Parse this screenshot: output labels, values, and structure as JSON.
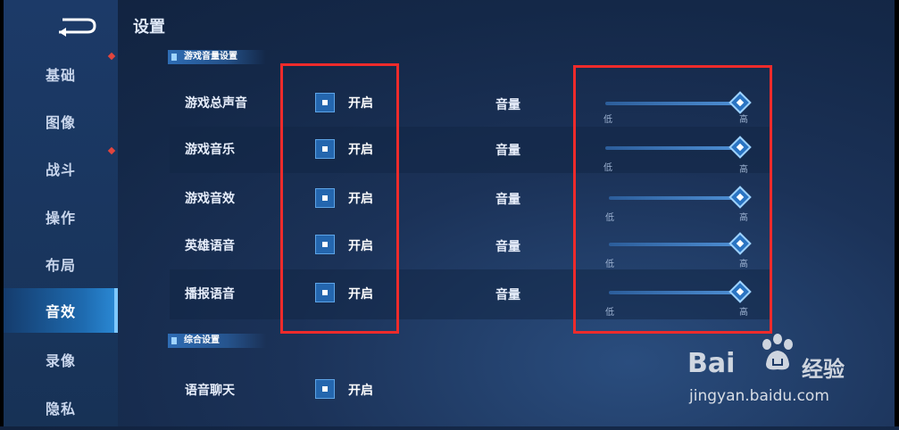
{
  "title": "设置",
  "sidebar": {
    "items": [
      {
        "label": "基础",
        "badge": true
      },
      {
        "label": "图像",
        "badge": false
      },
      {
        "label": "战斗",
        "badge": true
      },
      {
        "label": "操作",
        "badge": false
      },
      {
        "label": "布局",
        "badge": false
      },
      {
        "label": "音效",
        "badge": false,
        "active": true
      },
      {
        "label": "录像",
        "badge": false
      },
      {
        "label": "隐私",
        "badge": false
      }
    ]
  },
  "sections": {
    "volume": {
      "title": "游戏音量设置"
    },
    "general": {
      "title": "综合设置"
    }
  },
  "volume_rows": [
    {
      "label": "游戏总声音",
      "toggle": "开启",
      "volume_label": "音量",
      "low": "低",
      "high": "高",
      "level": 1.0
    },
    {
      "label": "游戏音乐",
      "toggle": "开启",
      "volume_label": "音量",
      "low": "低",
      "high": "高",
      "level": 1.0
    },
    {
      "label": "游戏音效",
      "toggle": "开启",
      "volume_label": "音量",
      "low": "低",
      "high": "高",
      "level": 1.0
    },
    {
      "label": "英雄语音",
      "toggle": "开启",
      "volume_label": "音量",
      "low": "低",
      "high": "高",
      "level": 1.0
    },
    {
      "label": "播报语音",
      "toggle": "开启",
      "volume_label": "音量",
      "low": "低",
      "high": "高",
      "level": 1.0
    }
  ],
  "general_rows": [
    {
      "label": "语音聊天",
      "toggle": "开启"
    }
  ],
  "watermark": {
    "brand": "Bai",
    "brand2": "经验",
    "url": "jingyan.baidu.com"
  },
  "colors": {
    "accent": "#2466ae",
    "highlight": "#ee2b2b",
    "badge": "#e2453d"
  }
}
